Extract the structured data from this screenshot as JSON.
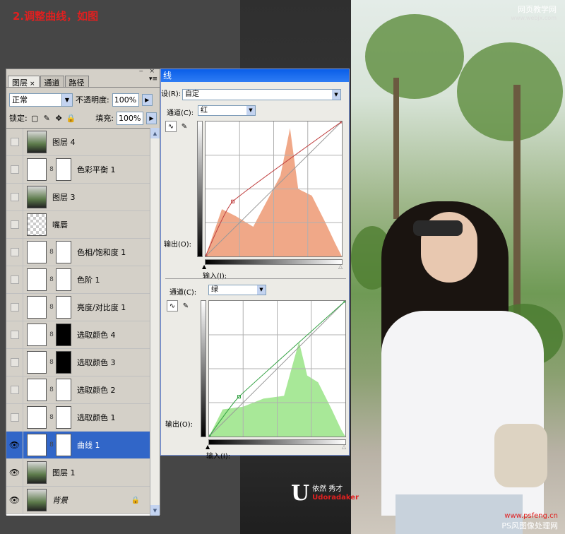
{
  "caption": "2.调整曲线，如图",
  "watermark_top": {
    "line1": "网页教学网",
    "line2": "www.webjx.com"
  },
  "watermark_bottom": {
    "url": "www.psfeng.cn",
    "name": "PS风图像处理网"
  },
  "signature": {
    "initial": "U",
    "name": "依然 秀才",
    "tag": "Udoradaker"
  },
  "layers_panel": {
    "tabs": [
      {
        "label": "图层",
        "close": "×"
      },
      {
        "label": "通道"
      },
      {
        "label": "路径"
      }
    ],
    "blend_mode": "正常",
    "opacity_label": "不透明度:",
    "opacity_value": "100%",
    "lock_label": "锁定:",
    "fill_label": "填充:",
    "fill_value": "100%",
    "layers": [
      {
        "name": "图层 4",
        "visible": false,
        "thumb": "photo",
        "mask": "none"
      },
      {
        "name": "色彩平衡 1",
        "visible": false,
        "thumb": "adj",
        "mask": "white"
      },
      {
        "name": "图层 3",
        "visible": false,
        "thumb": "photo",
        "mask": "none"
      },
      {
        "name": "嘴唇",
        "visible": false,
        "thumb": "checker",
        "mask": "none"
      },
      {
        "name": "色相/饱和度 1",
        "visible": false,
        "thumb": "adj",
        "mask": "white"
      },
      {
        "name": "色阶 1",
        "visible": false,
        "thumb": "adj",
        "mask": "white"
      },
      {
        "name": "亮度/对比度 1",
        "visible": false,
        "thumb": "adj",
        "mask": "white"
      },
      {
        "name": "选取颜色 4",
        "visible": false,
        "thumb": "adj",
        "mask": "black"
      },
      {
        "name": "选取颜色 3",
        "visible": false,
        "thumb": "adj",
        "mask": "black"
      },
      {
        "name": "选取颜色 2",
        "visible": false,
        "thumb": "adj",
        "mask": "white"
      },
      {
        "name": "选取颜色 1",
        "visible": false,
        "thumb": "adj",
        "mask": "white"
      },
      {
        "name": "曲线 1",
        "visible": true,
        "thumb": "adj",
        "mask": "white",
        "selected": true
      },
      {
        "name": "图层 1",
        "visible": true,
        "thumb": "photo",
        "mask": "none"
      },
      {
        "name": "背景",
        "visible": true,
        "thumb": "photo",
        "mask": "none",
        "italic": true,
        "locked": true
      }
    ]
  },
  "curves_dialog": {
    "title": "线",
    "preset_label": "设(R):",
    "preset_value": "自定",
    "panels": [
      {
        "channel_label": "通道(C):",
        "channel_value": "红",
        "output_label": "输出(O):",
        "input_label": "输入(I):",
        "color": "#f0a888",
        "curve_color": "#c04040"
      },
      {
        "channel_label": "通道(C):",
        "channel_value": "绿",
        "output_label": "输出(O):",
        "input_label": "输入(I):",
        "color": "#a8e898",
        "curve_color": "#30a040"
      }
    ]
  }
}
